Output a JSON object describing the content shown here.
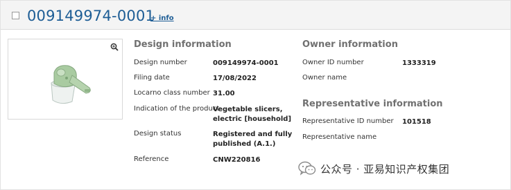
{
  "header": {
    "design_id": "009149974-0001",
    "info_link": "+ info"
  },
  "design_info": {
    "title": "Design information",
    "rows": [
      {
        "label": "Design number",
        "value": "009149974-0001"
      },
      {
        "label": "Filing date",
        "value": "17/08/2022"
      },
      {
        "label": "Locarno class number",
        "value": "31.00"
      },
      {
        "label": "Indication of the product",
        "value": "Vegetable slicers, electric [household]"
      },
      {
        "label": "Design status",
        "value": "Registered and fully published (A.1.)"
      },
      {
        "label": "Reference",
        "value": "CNW220816"
      }
    ]
  },
  "owner_info": {
    "title": "Owner information",
    "rows": [
      {
        "label": "Owner ID number",
        "value": "1333319"
      },
      {
        "label": "Owner name",
        "value": ""
      }
    ]
  },
  "rep_info": {
    "title": "Representative information",
    "rows": [
      {
        "label": "Representative ID number",
        "value": "101518"
      },
      {
        "label": "Representative name",
        "value": ""
      }
    ]
  },
  "watermark": {
    "text": "公众号 · 亚易知识产权集团"
  },
  "icons": {
    "zoom": "zoom-in-icon",
    "checkbox": "checkbox-icon",
    "watermark": "wechat-icon"
  }
}
